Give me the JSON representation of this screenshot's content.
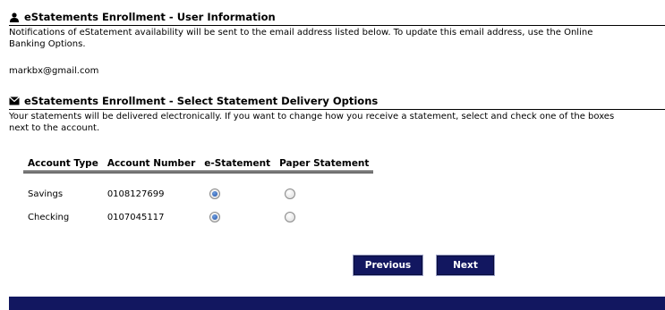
{
  "user_info": {
    "heading": "eStatements Enrollment - User Information",
    "icon": "user-icon",
    "notice": "Notifications of eStatement availability will be sent to the email address listed below. To update this email address, use the Online Banking Options.",
    "email": "markbx@gmail.com"
  },
  "delivery": {
    "heading": "eStatements Enrollment - Select Statement Delivery Options",
    "icon": "envelope-icon",
    "notice": "Your statements will be delivered electronically. If you want to change how you receive a statement, select and check one of the boxes next to the account."
  },
  "table": {
    "headers": [
      "Account Type",
      "Account Number",
      "e-Statement",
      "Paper Statement"
    ],
    "rows": [
      {
        "type": "Savings",
        "number": "0108127699",
        "selected": "e-Statement"
      },
      {
        "type": "Checking",
        "number": "0107045117",
        "selected": "e-Statement"
      }
    ]
  },
  "buttons": {
    "previous": "Previous",
    "next": "Next"
  },
  "colors": {
    "button_bg": "#121760",
    "footer_bar": "#121760"
  }
}
